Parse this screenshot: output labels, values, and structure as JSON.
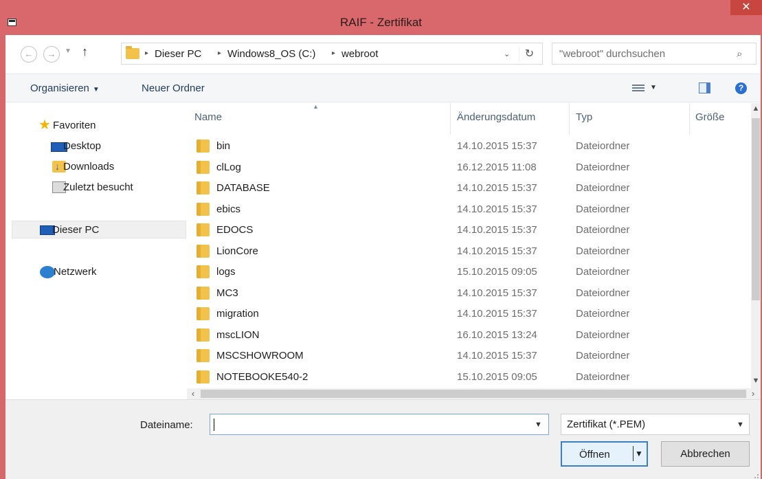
{
  "window": {
    "title": "RAIF - Zertifikat",
    "close_glyph": "✕"
  },
  "nav_buttons": {
    "back": "←",
    "forward": "→",
    "recent": "▼",
    "up": "↑"
  },
  "address": {
    "crumbs": [
      "Dieser PC",
      "Windows8_OS (C:)",
      "webroot"
    ],
    "sep": "▸",
    "dropdown": "⌄",
    "refresh": "↻"
  },
  "search": {
    "placeholder": "\"webroot\" durchsuchen",
    "icon": "⌕"
  },
  "toolbar": {
    "organize": "Organisieren",
    "organize_caret": "▼",
    "new_folder": "Neuer Ordner",
    "view_caret": "▼",
    "help": "?"
  },
  "nav_pane": {
    "favorites": "Favoriten",
    "items": [
      {
        "label": "Desktop",
        "icon": "desktop-icon"
      },
      {
        "label": "Downloads",
        "icon": "downloads-icon"
      },
      {
        "label": "Zuletzt besucht",
        "icon": "recent-places-icon"
      }
    ],
    "this_pc": "Dieser PC",
    "network": "Netzwerk"
  },
  "columns": {
    "name": "Name",
    "date": "Änderungsdatum",
    "type": "Typ",
    "size": "Größe",
    "sort_indicator": "▲"
  },
  "files": [
    {
      "name": "bin",
      "date": "14.10.2015 15:37",
      "type": "Dateiordner"
    },
    {
      "name": "clLog",
      "date": "16.12.2015 11:08",
      "type": "Dateiordner"
    },
    {
      "name": "DATABASE",
      "date": "14.10.2015 15:37",
      "type": "Dateiordner"
    },
    {
      "name": "ebics",
      "date": "14.10.2015 15:37",
      "type": "Dateiordner"
    },
    {
      "name": "EDOCS",
      "date": "14.10.2015 15:37",
      "type": "Dateiordner"
    },
    {
      "name": "LionCore",
      "date": "14.10.2015 15:37",
      "type": "Dateiordner"
    },
    {
      "name": "logs",
      "date": "15.10.2015 09:05",
      "type": "Dateiordner"
    },
    {
      "name": "MC3",
      "date": "14.10.2015 15:37",
      "type": "Dateiordner"
    },
    {
      "name": "migration",
      "date": "14.10.2015 15:37",
      "type": "Dateiordner"
    },
    {
      "name": "mscLION",
      "date": "16.10.2015 13:24",
      "type": "Dateiordner"
    },
    {
      "name": "MSCSHOWROOM",
      "date": "14.10.2015 15:37",
      "type": "Dateiordner"
    },
    {
      "name": "NOTEBOOKE540-2",
      "date": "15.10.2015 09:05",
      "type": "Dateiordner"
    }
  ],
  "scrollbars": {
    "up": "▲",
    "down": "▼",
    "left": "‹",
    "right": "›"
  },
  "bottom": {
    "filename_label": "Dateiname:",
    "filename_value": "",
    "filename_drop": "▼",
    "filter": "Zertifikat (*.PEM)",
    "filter_drop": "▼",
    "open": "Öffnen",
    "open_drop": "▼",
    "cancel": "Abbrechen"
  },
  "colors": {
    "titlebar": "#d8686b",
    "close": "#c7463f",
    "accent": "#3c7fc1",
    "folder": "#f2c24a"
  }
}
